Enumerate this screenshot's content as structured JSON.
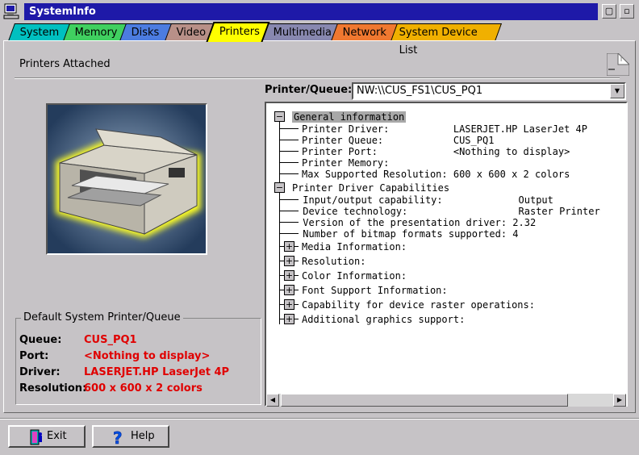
{
  "window": {
    "title": "SystemInfo",
    "minimize_glyph": "▢",
    "restore_glyph": "▫"
  },
  "tabs": [
    {
      "label": "System",
      "color": "#00c0c0"
    },
    {
      "label": "Memory",
      "color": "#40d060"
    },
    {
      "label": "Disks",
      "color": "#4c7ce0"
    },
    {
      "label": "Video",
      "color": "#b89088"
    },
    {
      "label": "Printers",
      "color": "#ffff00",
      "active": true
    },
    {
      "label": "Multimedia",
      "color": "#8888b0"
    },
    {
      "label": "Network",
      "color": "#f07830"
    },
    {
      "label": "System Device List",
      "color": "#f0b000"
    }
  ],
  "section": {
    "title": "Printers Attached"
  },
  "default_printer": {
    "group_title": "Default System Printer/Queue",
    "rows": [
      {
        "label": "Queue:",
        "value": "CUS_PQ1"
      },
      {
        "label": "Port:",
        "value": "<Nothing to display>"
      },
      {
        "label": "Driver:",
        "value": "LASERJET.HP LaserJet 4P"
      },
      {
        "label": "Resolution:",
        "value": "600 x 600 x 2 colors"
      }
    ],
    "value_color": "#e00000"
  },
  "printer_queue": {
    "label": "Printer/Queue:",
    "value": "NW:\\\\CUS_FS1\\CUS_PQ1"
  },
  "tree": {
    "general": {
      "title": "General information",
      "items": [
        "Printer Driver:           LASERJET.HP LaserJet 4P",
        "Printer Queue:            CUS_PQ1",
        "Printer Port:             <Nothing to display>",
        "Printer Memory:",
        "Max Supported Resolution: 600 x 600 x 2 colors"
      ]
    },
    "capabilities": {
      "title": "Printer Driver Capabilities",
      "items": [
        " Input/output capability:             Output",
        " Device technology:                   Raster Printer",
        " Version of the presentation driver: 2.32",
        " Number of bitmap formats supported: 4"
      ],
      "collapsed": [
        "Media Information:",
        "Resolution:",
        "Color Information:",
        "Font Support Information:",
        "Capability for device raster operations:",
        "Additional graphics support:"
      ]
    }
  },
  "buttons": {
    "exit": "Exit",
    "help": "Help"
  }
}
